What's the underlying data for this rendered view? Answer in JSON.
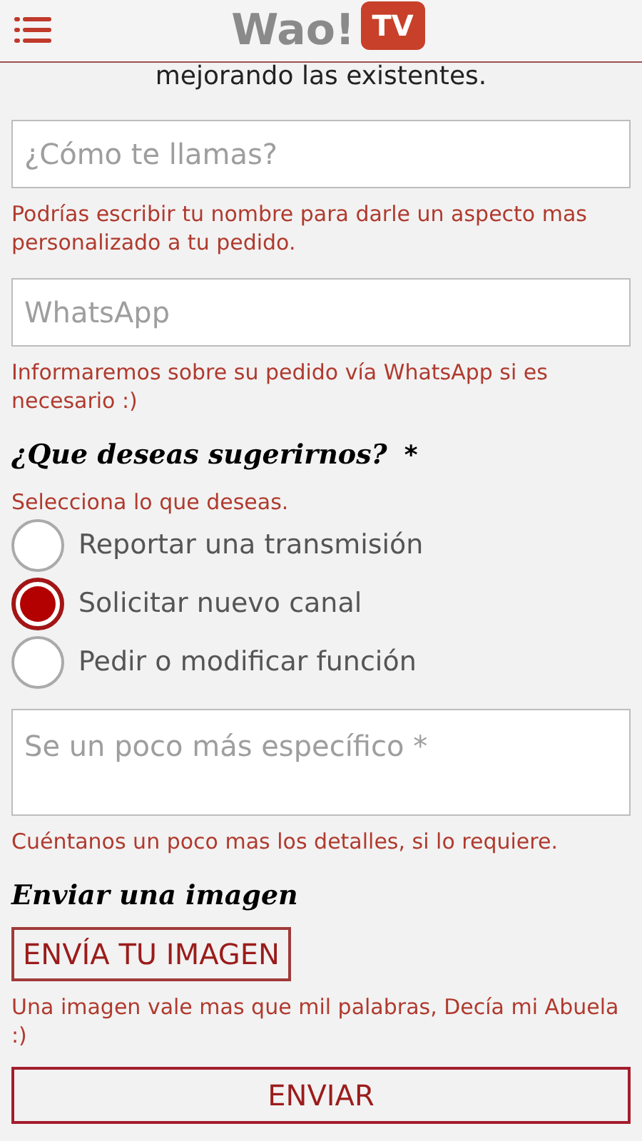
{
  "header": {
    "logo_text": "Wao!",
    "logo_badge": "TV"
  },
  "intro_text": "mejorando las existentes.",
  "name_field": {
    "placeholder": "¿Cómo te llamas?",
    "help": "Podrías escribir tu nombre para darle un aspecto mas personalizado a tu pedido."
  },
  "whatsapp_field": {
    "placeholder": "WhatsApp",
    "help": "Informaremos sobre su pedido vía WhatsApp si es necesario :)"
  },
  "suggestion": {
    "heading": "¿Que deseas sugerirnos?",
    "required_mark": "*",
    "help": "Selecciona lo que deseas.",
    "options": [
      {
        "label": "Reportar una transmisión",
        "selected": false
      },
      {
        "label": "Solicitar nuevo canal",
        "selected": true
      },
      {
        "label": "Pedir o modificar función",
        "selected": false
      }
    ]
  },
  "details_field": {
    "placeholder": "Se un poco más específico *",
    "help": "Cuéntanos un poco mas los detalles, si lo requiere."
  },
  "image_section": {
    "heading": "Enviar una imagen",
    "button": "ENVÍA TU IMAGEN",
    "help": "Una imagen vale mas que mil palabras, Decía mi Abuela :)"
  },
  "submit_button": "ENVIAR"
}
